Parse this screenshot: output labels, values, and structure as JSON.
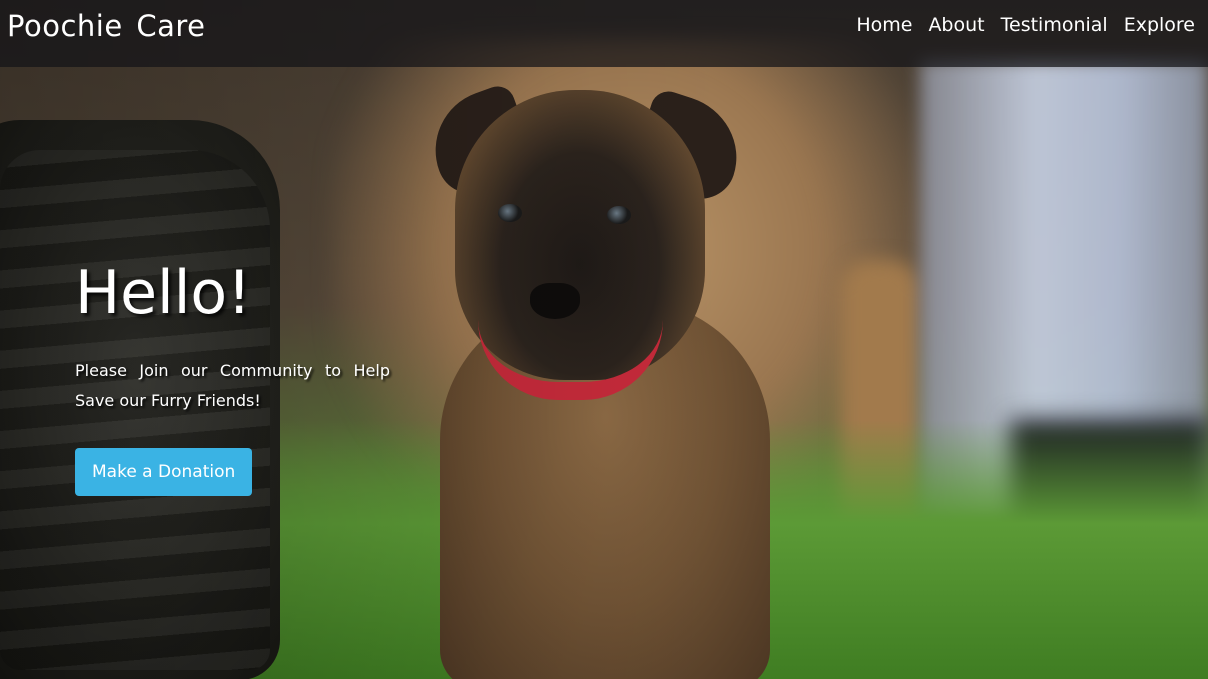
{
  "navbar": {
    "brand": "Poochie Care",
    "links": [
      {
        "label": "Home"
      },
      {
        "label": "About"
      },
      {
        "label": "Testimonial"
      },
      {
        "label": "Explore"
      }
    ]
  },
  "hero": {
    "title": "Hello!",
    "subtitle": "Please Join our Community to Help Save our Furry Friends!",
    "cta_label": "Make a Donation"
  },
  "colors": {
    "navbar_bg": "#141418",
    "cta_bg": "#3ab3e4",
    "text": "#ffffff",
    "collar_red": "#c42a3a"
  }
}
